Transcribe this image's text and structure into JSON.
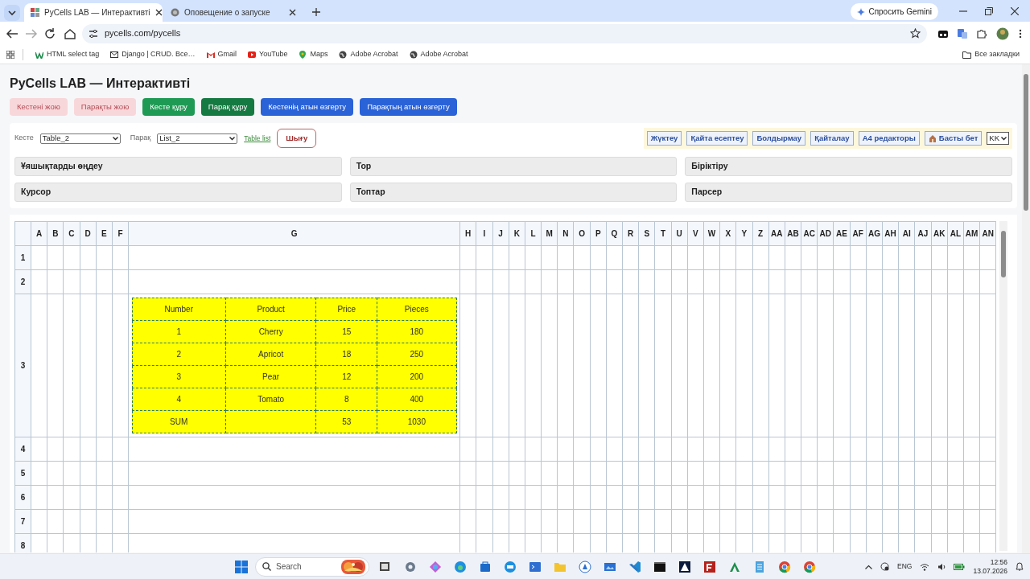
{
  "browser": {
    "tabs": [
      {
        "title": "PyCells LAB — Интерактивті",
        "selected": true
      },
      {
        "title": "Оповещение о запуске",
        "selected": false
      }
    ],
    "gemini_button": "Спросить Gemini",
    "address": "pycells.com/pycells",
    "bookmarks": [
      {
        "label": "HTML select tag",
        "kind": "w"
      },
      {
        "label": "Django | CRUD. Все…",
        "kind": "mail"
      },
      {
        "label": "Gmail",
        "kind": "gmail"
      },
      {
        "label": "YouTube",
        "kind": "youtube"
      },
      {
        "label": "Maps",
        "kind": "maps"
      },
      {
        "label": "Adobe Acrobat",
        "kind": "globe"
      },
      {
        "label": "Adobe Acrobat",
        "kind": "globe"
      }
    ],
    "all_bookmarks": "Все закладки"
  },
  "page": {
    "title": "PyCells LAB — Интерактивті",
    "action_buttons": [
      {
        "label": "Кестені жою",
        "kind": "delete"
      },
      {
        "label": "Парақты жою",
        "kind": "delete"
      },
      {
        "label": "Кесте құру",
        "kind": "create"
      },
      {
        "label": "Парақ құру",
        "kind": "createsheet"
      },
      {
        "label": "Кестенің атын өзгерту",
        "kind": "rename"
      },
      {
        "label": "Парақтың атын өзгерту",
        "kind": "rename"
      }
    ],
    "table_select": {
      "label": "Кесте",
      "value": "Table_2"
    },
    "sheet_select": {
      "label": "Парақ",
      "value": "List_2"
    },
    "table_list_link": "Table list",
    "exit_button": "Шығу",
    "toolbar": [
      {
        "label": "Жүктеу",
        "kind": "text"
      },
      {
        "label": "Қайта есептеу",
        "kind": "text"
      },
      {
        "label": "Болдырмау",
        "kind": "text"
      },
      {
        "label": "Қайталау",
        "kind": "text"
      },
      {
        "label": "A4 редакторы",
        "kind": "text"
      },
      {
        "label": "Басты бет",
        "kind": "home"
      }
    ],
    "language": "KK",
    "sections": [
      "Ұяшықтарды өңдеу",
      "Тор",
      "Біріктіру",
      "Курсор",
      "Топтар",
      "Парсер"
    ],
    "grid": {
      "columns": [
        {
          "label": "A",
          "kind": "narrow"
        },
        {
          "label": "B",
          "kind": "narrow"
        },
        {
          "label": "C",
          "kind": "narrow"
        },
        {
          "label": "D",
          "kind": "narrow"
        },
        {
          "label": "E",
          "kind": "narrow"
        },
        {
          "label": "F",
          "kind": "narrow"
        },
        {
          "label": "G",
          "kind": "wide"
        },
        {
          "label": "H",
          "kind": "narrow"
        },
        {
          "label": "I",
          "kind": "narrow"
        },
        {
          "label": "J",
          "kind": "narrow"
        },
        {
          "label": "K",
          "kind": "narrow"
        },
        {
          "label": "L",
          "kind": "narrow"
        },
        {
          "label": "M",
          "kind": "narrow"
        },
        {
          "label": "N",
          "kind": "narrow"
        },
        {
          "label": "O",
          "kind": "narrow"
        },
        {
          "label": "P",
          "kind": "narrow"
        },
        {
          "label": "Q",
          "kind": "narrow"
        },
        {
          "label": "R",
          "kind": "narrow"
        },
        {
          "label": "S",
          "kind": "narrow"
        },
        {
          "label": "T",
          "kind": "narrow"
        },
        {
          "label": "U",
          "kind": "narrow"
        },
        {
          "label": "V",
          "kind": "narrow"
        },
        {
          "label": "W",
          "kind": "narrow"
        },
        {
          "label": "X",
          "kind": "narrow"
        },
        {
          "label": "Y",
          "kind": "narrow"
        },
        {
          "label": "Z",
          "kind": "narrow"
        },
        {
          "label": "AA",
          "kind": "narrow"
        },
        {
          "label": "AB",
          "kind": "narrow"
        },
        {
          "label": "AC",
          "kind": "narrow"
        },
        {
          "label": "AD",
          "kind": "narrow"
        },
        {
          "label": "AE",
          "kind": "narrow"
        },
        {
          "label": "AF",
          "kind": "narrow"
        },
        {
          "label": "AG",
          "kind": "narrow"
        },
        {
          "label": "AH",
          "kind": "narrow"
        },
        {
          "label": "AI",
          "kind": "narrow"
        },
        {
          "label": "AJ",
          "kind": "narrow"
        },
        {
          "label": "AK",
          "kind": "narrow"
        },
        {
          "label": "AL",
          "kind": "narrow"
        },
        {
          "label": "AM",
          "kind": "narrow"
        },
        {
          "label": "AN",
          "kind": "narrow"
        }
      ],
      "rows": [
        {
          "label": "1",
          "kind": "plain"
        },
        {
          "label": "2",
          "kind": "plain"
        },
        {
          "label": "3",
          "kind": "table"
        },
        {
          "label": "4",
          "kind": "plain"
        },
        {
          "label": "5",
          "kind": "plain"
        },
        {
          "label": "6",
          "kind": "plain"
        },
        {
          "label": "7",
          "kind": "plain"
        },
        {
          "label": "8",
          "kind": "plain"
        }
      ],
      "table": {
        "columns": [
          "Number",
          "Product",
          "Price",
          "Pieces"
        ],
        "rows": [
          [
            "1",
            "Cherry",
            "15",
            "180"
          ],
          [
            "2",
            "Apricot",
            "18",
            "250"
          ],
          [
            "3",
            "Pear",
            "12",
            "200"
          ],
          [
            "4",
            "Tomato",
            "8",
            "400"
          ],
          [
            "SUM",
            null,
            "53",
            "1030"
          ]
        ]
      }
    }
  },
  "taskbar": {
    "search_placeholder": "Search",
    "language": "ENG",
    "time": "12:56",
    "date": "13.07.2026"
  }
}
